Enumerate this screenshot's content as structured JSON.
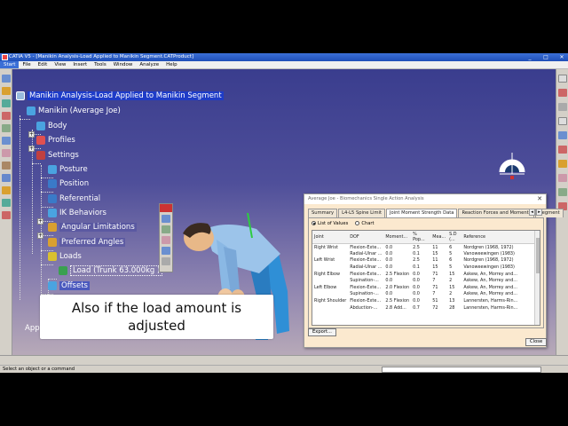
{
  "window": {
    "title": "CATIA V5 - [Manikin Analysis-Load Applied to Manikin Segment.CATProduct]",
    "controls": [
      "_",
      "□",
      "✕"
    ]
  },
  "menu": [
    "Start",
    "File",
    "Edit",
    "View",
    "Insert",
    "Tools",
    "Window",
    "Analyze",
    "Help"
  ],
  "tree": {
    "root": "Manikin Analysis-Load Applied to Manikin Segment",
    "manikin": "Manikin (Average Joe)",
    "body": "Body",
    "profiles": "Profiles",
    "settings": "Settings",
    "posture": "Posture",
    "position": "Position",
    "referential": "Referential",
    "ik_behaviors": "IK Behaviors",
    "angular_limitations": "Angular Limitations",
    "preferred_angles": "Preferred Angles",
    "loads": "Loads",
    "load_item": "Load (Trunk 63.000kg )",
    "offsets": "Offsets",
    "app_partial": "App"
  },
  "dialog": {
    "title": "Average Joe - Biomechanics Single Action Analysis",
    "tabs": [
      "Summary",
      "L4-L5 Spine Limit",
      "Joint Moment Strength Data",
      "Reaction Forces and Moments",
      "Segment"
    ],
    "active_tab": "Joint Moment Strength Data",
    "radio_list": "List of Values",
    "radio_chart": "Chart",
    "columns": [
      "Joint",
      "DOF",
      "Moment...",
      "% Pop...",
      "Mea...",
      "S.D (...",
      "Reference"
    ],
    "rows": [
      [
        "Right Wrist",
        "Flexion-Exte...",
        "0.0",
        "2.5",
        "11",
        "6",
        "Nordgren (1968, 1972)"
      ],
      [
        "",
        "Radial-Ulnar ...",
        "0.0",
        "0.1",
        "15",
        "5",
        "Vanoweewingen (1983)"
      ],
      [
        "Left Wrist",
        "Flexion-Exte...",
        "0.0",
        "2.5",
        "11",
        "6",
        "Nordgren (1968, 1972)"
      ],
      [
        "",
        "Radial-Ulnar ...",
        "0.0",
        "0.1",
        "15",
        "5",
        "Vanoweewingen (1983)"
      ],
      [
        "Right Elbow",
        "Flexion-Exte...",
        "2.5 Flexion",
        "0.0",
        "71",
        "15",
        "Askew, An, Morrey and..."
      ],
      [
        "",
        "Supination-...",
        "0.0",
        "0.0",
        "7",
        "2",
        "Askew, An, Morrey and..."
      ],
      [
        "Left Elbow",
        "Flexion-Exte...",
        "2.0 Flexion",
        "0.0",
        "71",
        "15",
        "Askew, An, Morrey and..."
      ],
      [
        "",
        "Supination-...",
        "0.0",
        "0.0",
        "7",
        "2",
        "Askew, An, Morrey and..."
      ],
      [
        "Right Shoulder",
        "Flexion-Exte...",
        "2.5 Flexion",
        "0.0",
        "51",
        "13",
        "Lannersten, Harms-Rin..."
      ],
      [
        "",
        "Abduction-...",
        "2.8 Add...",
        "0.7",
        "72",
        "28",
        "Lannersten, Harms-Rin..."
      ]
    ],
    "export_label": "Export...",
    "close_label": "Close"
  },
  "status": {
    "message": "Select an object or a command"
  },
  "caption": {
    "line1": "Also if the load amount is",
    "line2": "adjusted"
  },
  "colors": {
    "highlight": "#1e3cc8",
    "viewport_top": "#3a3d8e",
    "viewport_bottom": "#b7a9b8",
    "dialog_bg": "#fbe9cf"
  }
}
